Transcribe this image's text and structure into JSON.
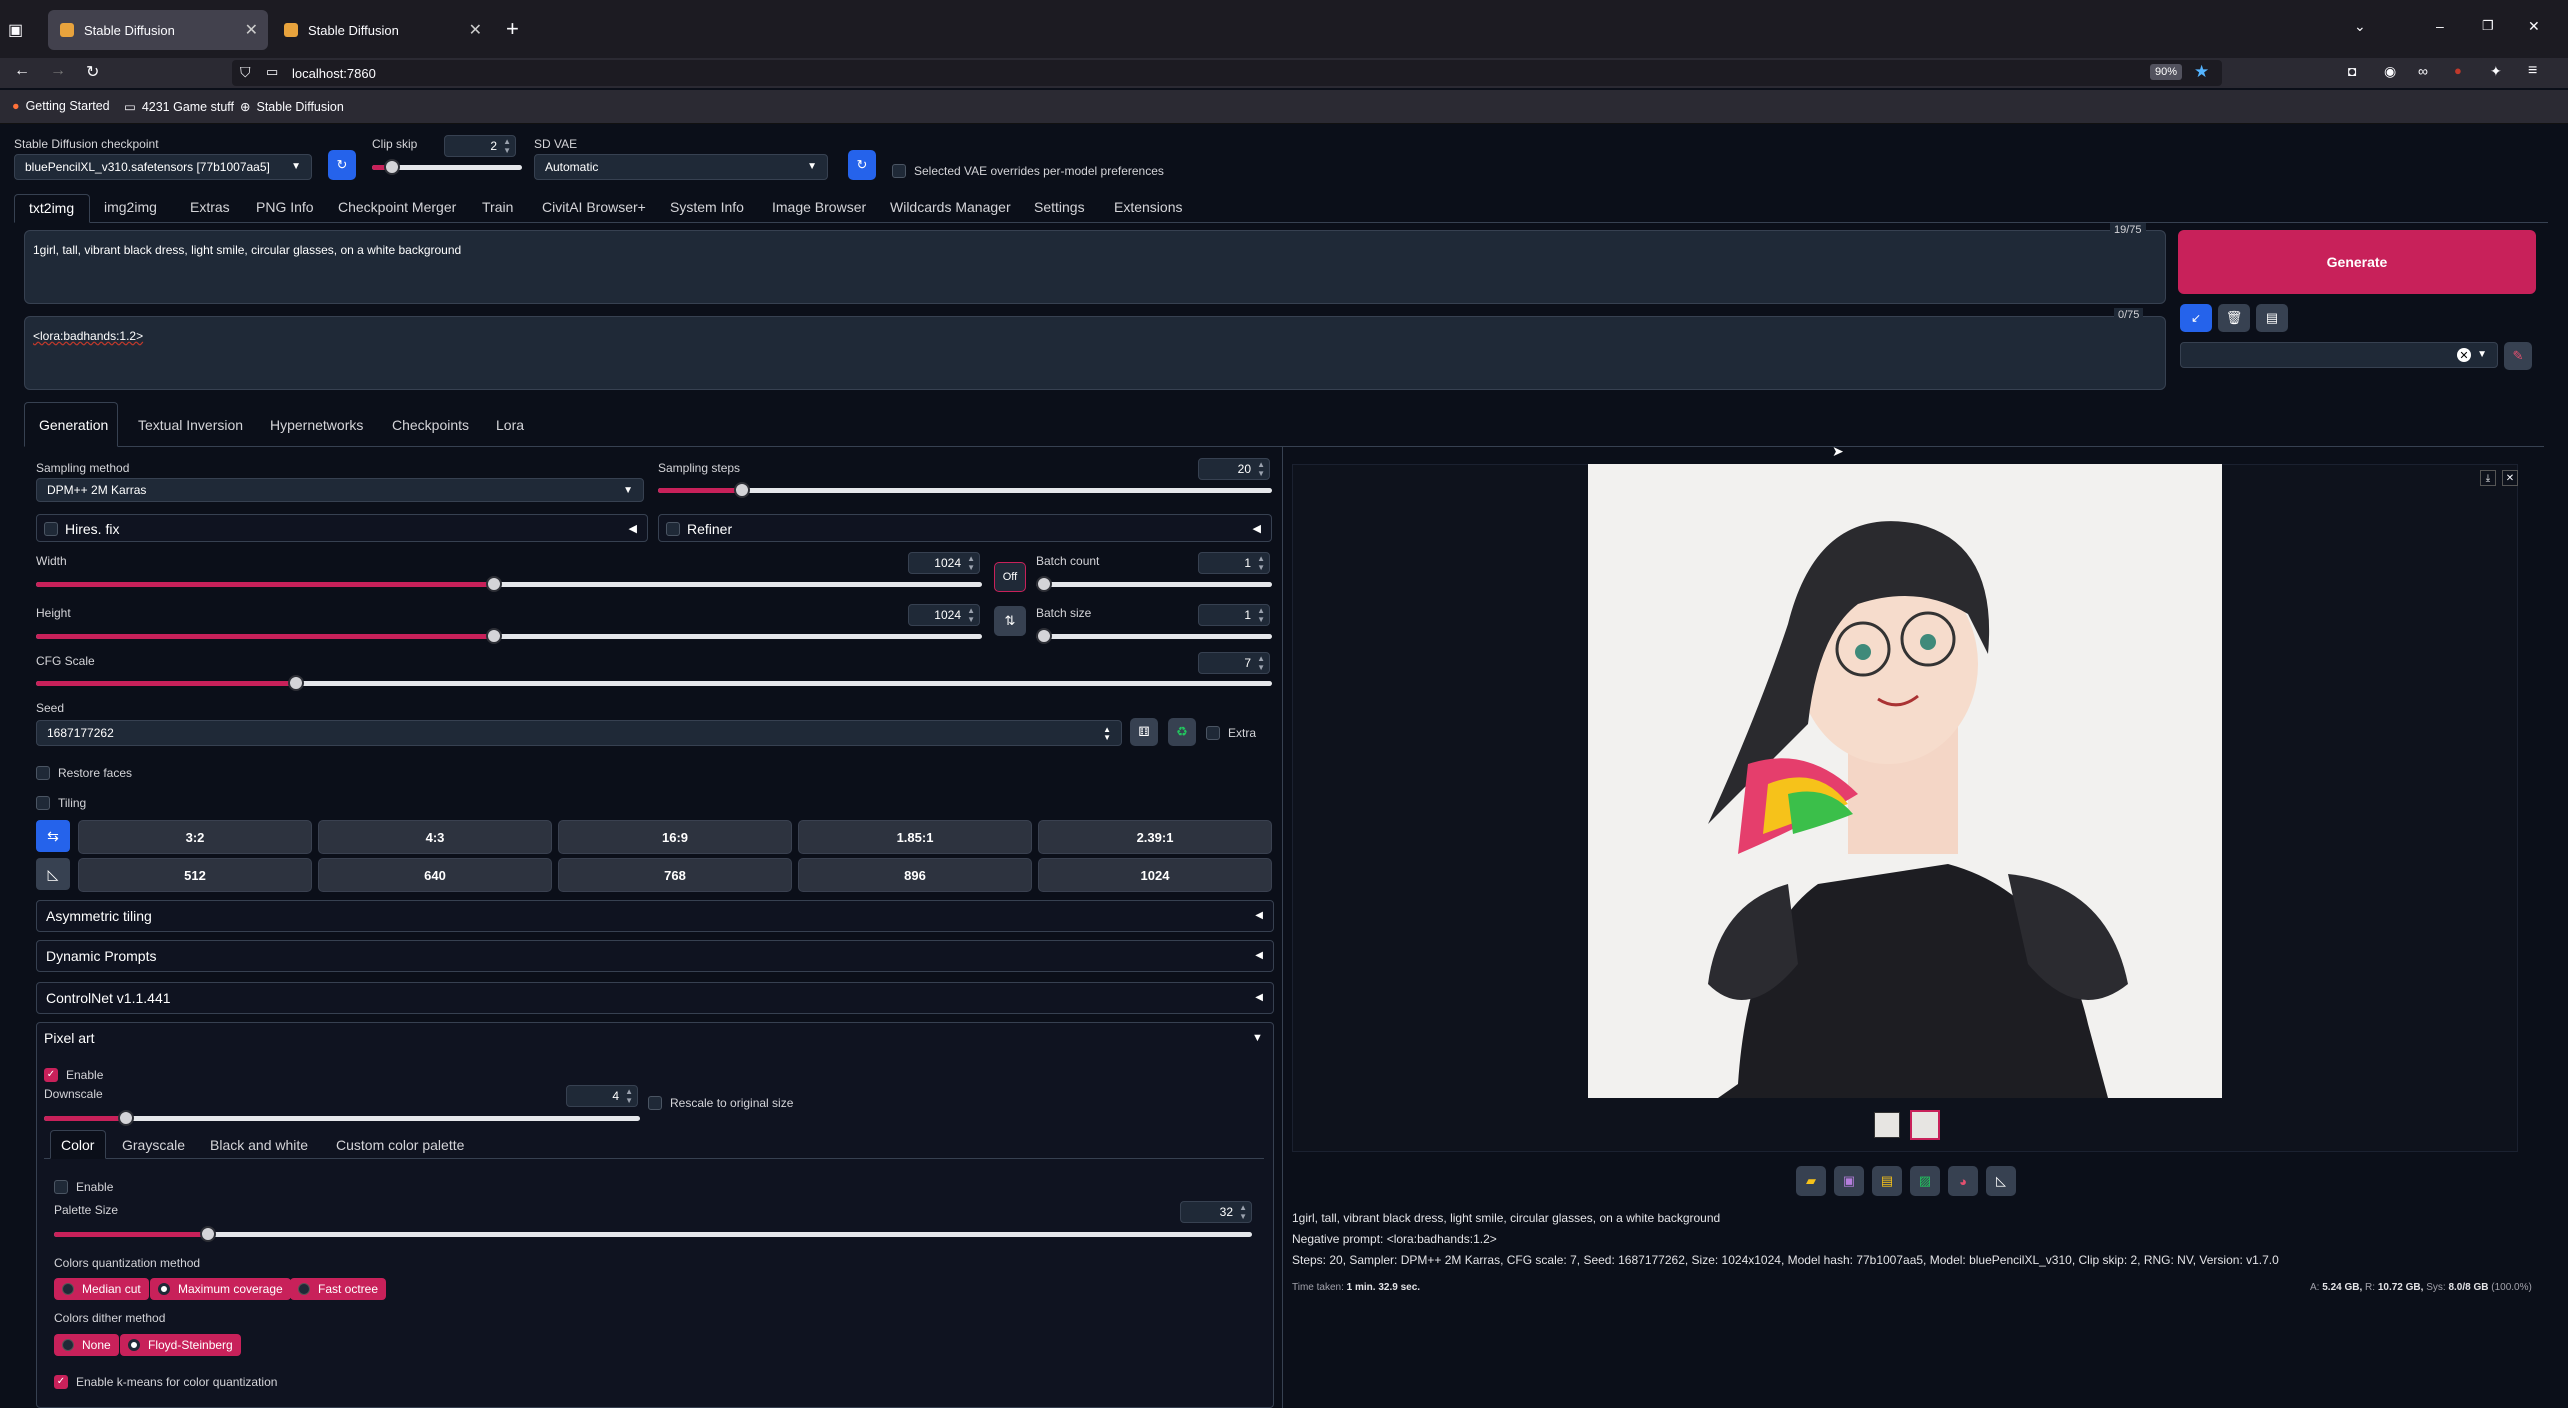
{
  "browser": {
    "tabs": [
      {
        "title": "Stable Diffusion"
      },
      {
        "title": "Stable Diffusion"
      }
    ],
    "url": "localhost:7860",
    "zoom": "90%",
    "bookmarks": [
      "Getting Started",
      "4231 Game stuff",
      "Stable Diffusion"
    ]
  },
  "top": {
    "checkpoint_label": "Stable Diffusion checkpoint",
    "checkpoint_value": "bluePencilXL_v310.safetensors [77b1007aa5]",
    "clip_skip_label": "Clip skip",
    "clip_skip_value": "2",
    "vae_label": "SD VAE",
    "vae_value": "Automatic",
    "vae_override_label": "Selected VAE overrides per-model preferences"
  },
  "main_tabs": [
    "txt2img",
    "img2img",
    "Extras",
    "PNG Info",
    "Checkpoint Merger",
    "Train",
    "CivitAI Browser+",
    "System Info",
    "Image Browser",
    "Wildcards Manager",
    "Settings",
    "Extensions"
  ],
  "prompt": {
    "positive": "1girl, tall, vibrant black dress, light smile, circular glasses, on a white background",
    "positive_count": "19/75",
    "negative": "<lora:badhands:1.2>",
    "negative_count": "0/75",
    "generate_label": "Generate"
  },
  "sub_tabs": [
    "Generation",
    "Textual Inversion",
    "Hypernetworks",
    "Checkpoints",
    "Lora"
  ],
  "generation": {
    "sampling_method_label": "Sampling method",
    "sampling_method_value": "DPM++ 2M Karras",
    "sampling_steps_label": "Sampling steps",
    "sampling_steps_value": "20",
    "hires_fix_label": "Hires. fix",
    "refiner_label": "Refiner",
    "width_label": "Width",
    "width_value": "1024",
    "height_label": "Height",
    "height_value": "1024",
    "swap_label": "Off",
    "batch_count_label": "Batch count",
    "batch_count_value": "1",
    "batch_size_label": "Batch size",
    "batch_size_value": "1",
    "cfg_label": "CFG Scale",
    "cfg_value": "7",
    "seed_label": "Seed",
    "seed_value": "1687177262",
    "extra_label": "Extra",
    "restore_faces_label": "Restore faces",
    "tiling_label": "Tiling",
    "ratios": [
      "3:2",
      "4:3",
      "16:9",
      "1.85:1",
      "2.39:1"
    ],
    "sizes": [
      "512",
      "640",
      "768",
      "896",
      "1024"
    ]
  },
  "sliders": {
    "sampling_steps": 0.2,
    "width": 1024,
    "height": 1024,
    "batch_count": 1,
    "batch_size": 1,
    "cfg": 7,
    "downscale": 4,
    "palette_size": 32
  },
  "accordions": {
    "asymmetric": "Asymmetric tiling",
    "dynamic": "Dynamic Prompts",
    "controlnet": "ControlNet v1.1.441",
    "pixel_art": "Pixel art"
  },
  "pixel_art": {
    "enable_label": "Enable",
    "downscale_label": "Downscale",
    "downscale_value": "4",
    "rescale_label": "Rescale to original size",
    "tabs": [
      "Color",
      "Grayscale",
      "Black and white",
      "Custom color palette"
    ],
    "color_enable_label": "Enable",
    "palette_size_label": "Palette Size",
    "palette_size_value": "32",
    "quant_label": "Colors quantization method",
    "quant_options": [
      "Median cut",
      "Maximum coverage",
      "Fast octree"
    ],
    "dither_label": "Colors dither method",
    "dither_options": [
      "None",
      "Floyd-Steinberg"
    ],
    "kmeans_label": "Enable k-means for color quantization"
  },
  "output": {
    "info_prompt": "1girl, tall, vibrant black dress, light smile, circular glasses, on a white background",
    "info_negative": "Negative prompt: <lora:badhands:1.2>",
    "info_params": "Steps: 20, Sampler: DPM++ 2M Karras, CFG scale: 7, Seed: 1687177262, Size: 1024x1024, Model hash: 77b1007aa5, Model: bluePencilXL_v310, Clip skip: 2, RNG: NV, Version: v1.7.0",
    "time_label": "Time taken:",
    "time_value": "1 min. 32.9 sec.",
    "vram_prefix": "A:",
    "vram_a": "5.24 GB,",
    "vram_r_prefix": "R:",
    "vram_r": "10.72 GB,",
    "vram_sys_prefix": "Sys:",
    "vram_sys": "8.0/8 GB",
    "vram_pct": "(100.0%)"
  },
  "colors": {
    "accent": "#c8215a",
    "bg": "#0b0f19",
    "panel": "#1f2937"
  }
}
